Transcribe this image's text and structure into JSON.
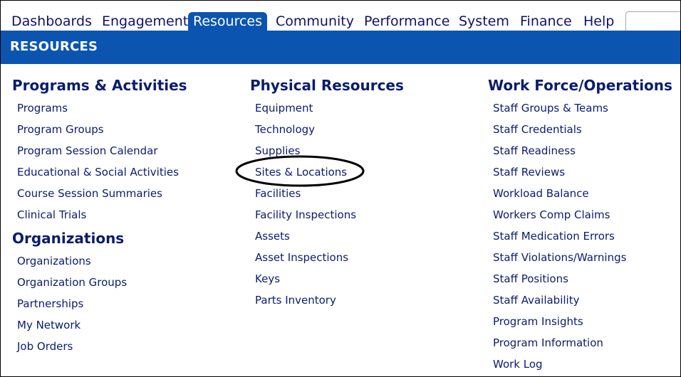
{
  "nav": {
    "tabs": [
      {
        "label": "Dashboards"
      },
      {
        "label": "Engagement"
      },
      {
        "label": "Resources"
      },
      {
        "label": "Community"
      },
      {
        "label": "Performance"
      },
      {
        "label": "System"
      },
      {
        "label": "Finance"
      },
      {
        "label": "Help"
      }
    ],
    "active_tab": "Resources"
  },
  "banner": {
    "title": "RESOURCES"
  },
  "columns": {
    "left": {
      "sections": [
        {
          "heading": "Programs & Activities",
          "links": [
            "Programs",
            "Program Groups",
            "Program Session Calendar",
            "Educational & Social Activities",
            "Course Session Summaries",
            "Clinical Trials"
          ]
        },
        {
          "heading": "Organizations",
          "links": [
            "Organizations",
            "Organization Groups",
            "Partnerships",
            "My Network",
            "Job Orders"
          ]
        }
      ]
    },
    "middle": {
      "sections": [
        {
          "heading": "Physical Resources",
          "links": [
            "Equipment",
            "Technology",
            "Supplies",
            "Sites & Locations",
            "Facilities",
            "Facility Inspections",
            "Assets",
            "Asset Inspections",
            "Keys",
            "Parts Inventory"
          ]
        }
      ]
    },
    "right": {
      "sections": [
        {
          "heading": "Work Force/Operations",
          "links": [
            "Staff Groups & Teams",
            "Staff Credentials",
            "Staff Readiness",
            "Staff Reviews",
            "Workload Balance",
            "Workers Comp Claims",
            "Staff Medication Errors",
            "Staff Violations/Warnings",
            "Staff Positions",
            "Staff Availability",
            "Program Insights",
            "Program Information",
            "Work Log"
          ]
        }
      ]
    }
  },
  "colors": {
    "accent": "#0b55b0",
    "text": "#0a1c6e",
    "annotation": "#000000"
  }
}
